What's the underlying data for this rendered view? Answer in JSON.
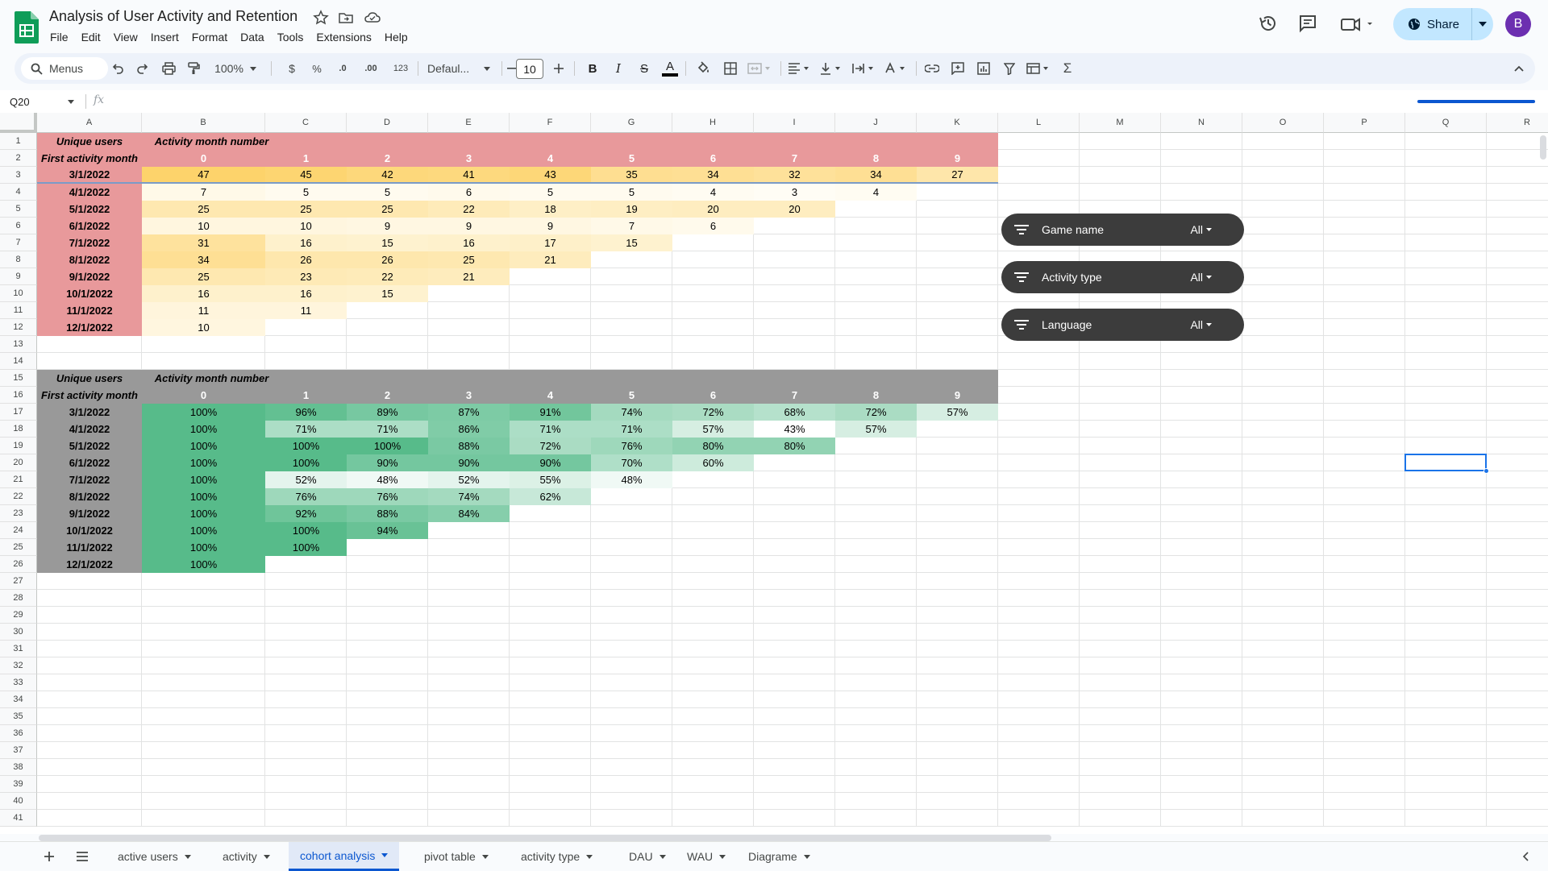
{
  "doc": {
    "title": "Analysis of User Activity and Retention",
    "menus": [
      "File",
      "Edit",
      "View",
      "Insert",
      "Format",
      "Data",
      "Tools",
      "Extensions",
      "Help"
    ],
    "share_label": "Share",
    "avatar_letter": "B"
  },
  "toolbar": {
    "search_label": "Menus",
    "zoom": "100%",
    "currency": "$",
    "percent": "%",
    "dec_decrease": ".0",
    "dec_increase": ".00",
    "number_format": "123",
    "font": "Defaul...",
    "font_size": "10",
    "bold": "B",
    "italic": "I",
    "strike": "S",
    "text_color": "A",
    "sum": "Σ"
  },
  "formula_bar": {
    "cell_ref": "Q20",
    "fx": "fx",
    "formula": ""
  },
  "columns": [
    "A",
    "B",
    "C",
    "D",
    "E",
    "F",
    "G",
    "H",
    "I",
    "J",
    "K",
    "L",
    "M",
    "N",
    "O",
    "P",
    "Q",
    "R"
  ],
  "rows": [
    "1",
    "2",
    "3",
    "4",
    "5",
    "6",
    "7",
    "8",
    "9",
    "10",
    "11",
    "12",
    "13",
    "14",
    "15",
    "16",
    "17",
    "18",
    "19",
    "20",
    "21",
    "22",
    "23",
    "24",
    "25",
    "26",
    "27",
    "28",
    "29",
    "30",
    "31",
    "32",
    "33",
    "34",
    "35",
    "36",
    "37",
    "38",
    "39",
    "40",
    "41"
  ],
  "cohort_counts": {
    "header_unique": "Unique users",
    "header_activity": "Activity month number",
    "header_first": "First activity month",
    "months_index": [
      "0",
      "1",
      "2",
      "3",
      "4",
      "5",
      "6",
      "7",
      "8",
      "9"
    ],
    "rows": [
      {
        "month": "3/1/2022",
        "values": [
          "47",
          "45",
          "42",
          "41",
          "43",
          "35",
          "34",
          "32",
          "34",
          "27"
        ]
      },
      {
        "month": "4/1/2022",
        "values": [
          "7",
          "5",
          "5",
          "6",
          "5",
          "5",
          "4",
          "3",
          "4"
        ]
      },
      {
        "month": "5/1/2022",
        "values": [
          "25",
          "25",
          "25",
          "22",
          "18",
          "19",
          "20",
          "20"
        ]
      },
      {
        "month": "6/1/2022",
        "values": [
          "10",
          "10",
          "9",
          "9",
          "9",
          "7",
          "6"
        ]
      },
      {
        "month": "7/1/2022",
        "values": [
          "31",
          "16",
          "15",
          "16",
          "17",
          "15"
        ]
      },
      {
        "month": "8/1/2022",
        "values": [
          "34",
          "26",
          "26",
          "25",
          "21"
        ]
      },
      {
        "month": "9/1/2022",
        "values": [
          "25",
          "23",
          "22",
          "21"
        ]
      },
      {
        "month": "10/1/2022",
        "values": [
          "16",
          "16",
          "15"
        ]
      },
      {
        "month": "11/1/2022",
        "values": [
          "11",
          "11"
        ]
      },
      {
        "month": "12/1/2022",
        "values": [
          "10"
        ]
      }
    ]
  },
  "cohort_pct": {
    "header_unique": "Unique users",
    "header_activity": "Activity month number",
    "header_first": "First activity month",
    "months_index": [
      "0",
      "1",
      "2",
      "3",
      "4",
      "5",
      "6",
      "7",
      "8",
      "9"
    ],
    "rows": [
      {
        "month": "3/1/2022",
        "values": [
          "100%",
          "96%",
          "89%",
          "87%",
          "91%",
          "74%",
          "72%",
          "68%",
          "72%",
          "57%"
        ]
      },
      {
        "month": "4/1/2022",
        "values": [
          "100%",
          "71%",
          "71%",
          "86%",
          "71%",
          "71%",
          "57%",
          "43%",
          "57%"
        ]
      },
      {
        "month": "5/1/2022",
        "values": [
          "100%",
          "100%",
          "100%",
          "88%",
          "72%",
          "76%",
          "80%",
          "80%"
        ]
      },
      {
        "month": "6/1/2022",
        "values": [
          "100%",
          "100%",
          "90%",
          "90%",
          "90%",
          "70%",
          "60%"
        ]
      },
      {
        "month": "7/1/2022",
        "values": [
          "100%",
          "52%",
          "48%",
          "52%",
          "55%",
          "48%"
        ]
      },
      {
        "month": "8/1/2022",
        "values": [
          "100%",
          "76%",
          "76%",
          "74%",
          "62%"
        ]
      },
      {
        "month": "9/1/2022",
        "values": [
          "100%",
          "92%",
          "88%",
          "84%"
        ]
      },
      {
        "month": "10/1/2022",
        "values": [
          "100%",
          "100%",
          "94%"
        ]
      },
      {
        "month": "11/1/2022",
        "values": [
          "100%",
          "100%"
        ]
      },
      {
        "month": "12/1/2022",
        "values": [
          "100%"
        ]
      }
    ]
  },
  "filters": [
    {
      "label": "Game name",
      "value": "All"
    },
    {
      "label": "Activity type",
      "value": "All"
    },
    {
      "label": "Language",
      "value": "All"
    }
  ],
  "sheets": [
    {
      "label": "active users",
      "active": false
    },
    {
      "label": "activity",
      "active": false
    },
    {
      "label": "cohort analysis",
      "active": true
    },
    {
      "label": "pivot table",
      "active": false
    },
    {
      "label": "activity type",
      "active": false
    },
    {
      "label": "DAU",
      "active": false
    },
    {
      "label": "WAU",
      "active": false
    },
    {
      "label": "Diagrame",
      "active": false
    }
  ],
  "colors": {
    "header_red": "#e8999b",
    "header_gray": "#999999",
    "count_max": "#fdd36b",
    "count_min": "#fffdf5",
    "pct_max": "#57bb8a",
    "pct_min": "#ffffff",
    "chip_bg": "#3c3c3c"
  }
}
